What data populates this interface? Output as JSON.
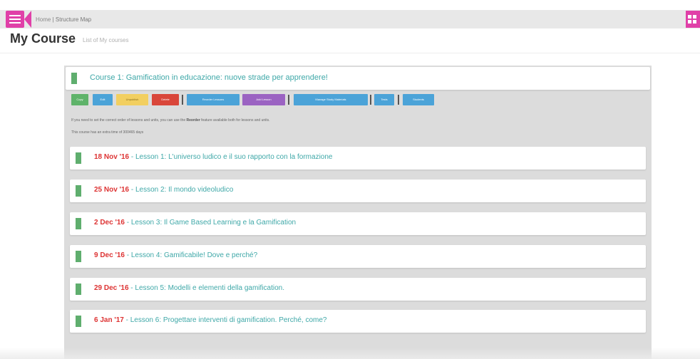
{
  "header": {
    "breadcrumb_home": "Home",
    "breadcrumb_separator": "|",
    "breadcrumb_current": "Structure Map"
  },
  "page": {
    "title": "My Course",
    "subtitle": "List of My courses"
  },
  "course": {
    "title": "Course 1: Gamification in educazione: nuove strade per apprendere!"
  },
  "toolbar": {
    "buttons": [
      {
        "label": "Copy",
        "color": "#5fb36a"
      },
      {
        "label": "Edit",
        "color": "#4ba3d8"
      },
      {
        "label": "Unpublish",
        "color": "#f2cf60"
      },
      {
        "label": "Delete",
        "color": "#d9463a"
      },
      {
        "label": "Reorder Lessons",
        "color": "#4ba3d8"
      },
      {
        "label": "Add Lesson",
        "color": "#9b63c2"
      },
      {
        "label": "Manage Study Materials",
        "color": "#4ba3d8"
      },
      {
        "label": "Tests",
        "color": "#4ba3d8"
      },
      {
        "label": "Students",
        "color": "#4ba3d8"
      }
    ]
  },
  "info": {
    "line1_before": "If you need to set the correct order of lessons and units, you can use the",
    "line1_bold": "Reorder",
    "line1_after": "feature available both for lessons and units.",
    "line2": "This course has an extra time of 300465 days"
  },
  "lessons": [
    {
      "date": "18 Nov '16",
      "title": "Lesson 1: L'universo ludico e il suo rapporto con la formazione"
    },
    {
      "date": "25 Nov '16",
      "title": "Lesson 2: Il mondo videoludico"
    },
    {
      "date": "2 Dec '16",
      "title": "Lesson 3: Il Game Based Learning e la Gamification"
    },
    {
      "date": "9 Dec '16",
      "title": "Lesson 4: Gamificabile! Dove e perché?"
    },
    {
      "date": "29 Dec '16",
      "title": "Lesson 5: Modelli e elementi della gamification."
    },
    {
      "date": "6 Jan '17",
      "title": "Lesson 6: Progettare interventi di gamification. Perché, come?"
    }
  ],
  "separators": {
    "dash": " - "
  },
  "colors": {
    "accent_pink": "#e040a8",
    "teal_link": "#3fa8a8",
    "date_red": "#dd3333",
    "marker_green": "#5fae6e"
  }
}
